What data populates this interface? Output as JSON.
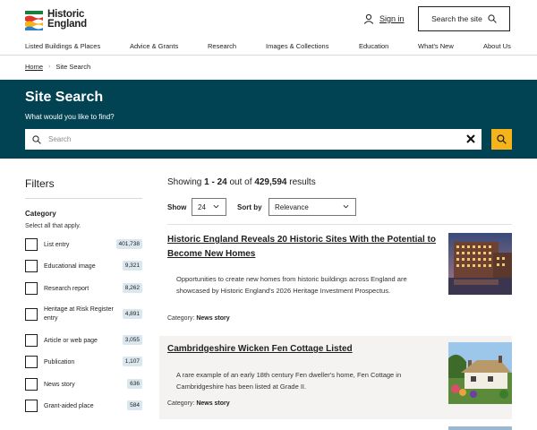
{
  "brand": {
    "line1": "Historic",
    "line2": "England"
  },
  "header": {
    "signin": "Sign in",
    "search_site": "Search the site"
  },
  "nav": [
    "Listed Buildings & Places",
    "Advice & Grants",
    "Research",
    "Images & Collections",
    "Education",
    "What's New",
    "About Us"
  ],
  "breadcrumb": {
    "home": "Home",
    "current": "Site Search"
  },
  "search": {
    "heading": "Site Search",
    "question": "What would you like to find?",
    "placeholder": "Search"
  },
  "filters": {
    "heading": "Filters",
    "category_label": "Category",
    "hint": "Select all that apply.",
    "items": [
      {
        "label": "List entry",
        "count": "401,738"
      },
      {
        "label": "Educational image",
        "count": "9,321"
      },
      {
        "label": "Research report",
        "count": "8,262"
      },
      {
        "label": "Heritage at Risk Register entry",
        "count": "4,891"
      },
      {
        "label": "Article or web page",
        "count": "3,055"
      },
      {
        "label": "Publication",
        "count": "1,107"
      },
      {
        "label": "News story",
        "count": "636"
      },
      {
        "label": "Grant-aided place",
        "count": "584"
      }
    ]
  },
  "results": {
    "showing_prefix": "Showing",
    "range": "1 - 24",
    "out_of": "out of",
    "total": "429,594",
    "suffix": "results",
    "show_label": "Show",
    "show_value": "24",
    "sort_label": "Sort by",
    "sort_value": "Relevance",
    "items": [
      {
        "title": "Historic England Reveals 20 Historic Sites With the Potential to Become New Homes",
        "description": "Opportunities to create new homes from historic buildings across England are showcased by Historic England's 2026 Heritage Investment Prospectus.",
        "category_label": "Category:",
        "category": "News story"
      },
      {
        "title": "Cambridgeshire Wicken Fen Cottage Listed",
        "description": "A rare example of an early 18th century Fen dweller's home, Fen Cottage in Cambridgeshire has been listed at Grade II.",
        "category_label": "Category:",
        "category": "News story"
      }
    ]
  },
  "colors": {
    "band": "#024353",
    "accent": "#f6b41a",
    "badge": "#dbe7ef"
  },
  "icons": [
    "logo-mark",
    "person-icon",
    "search-icon",
    "clear-icon",
    "chevron-down-icon"
  ]
}
